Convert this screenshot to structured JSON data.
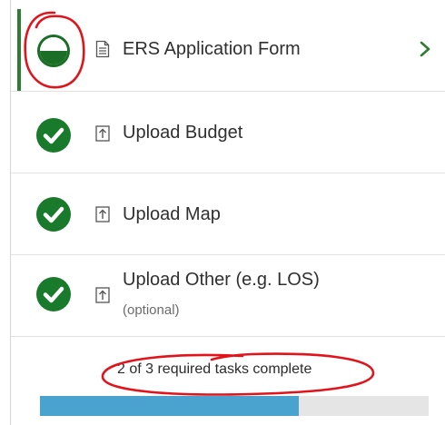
{
  "tasks": [
    {
      "label": "ERS Application Form",
      "status": "in-progress",
      "icon": "document-icon",
      "nav_icon": "chevron-right-icon"
    },
    {
      "label": "Upload Budget",
      "status": "complete",
      "icon": "upload-icon"
    },
    {
      "label": "Upload Map",
      "status": "complete",
      "icon": "upload-icon"
    },
    {
      "label": "Upload Other (e.g. LOS)",
      "sublabel": "(optional)",
      "status": "complete",
      "icon": "upload-icon"
    }
  ],
  "progress": {
    "text": "2 of 3 required tasks complete",
    "completed": 2,
    "required": 3,
    "fraction": 0.667
  },
  "colors": {
    "complete": "#187a2a",
    "active_bar": "#2e7d32",
    "chevron": "#2e7d32",
    "progress_fill": "#4aa3cf",
    "progress_track": "#e5e5e5",
    "annotation": "#e0141a"
  }
}
